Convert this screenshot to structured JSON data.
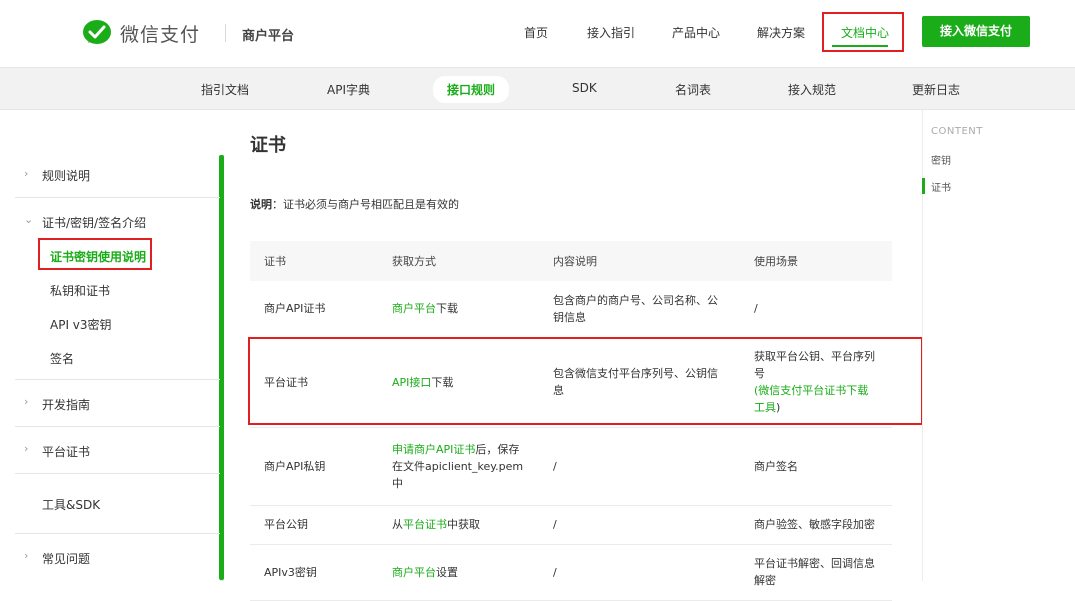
{
  "header": {
    "brand": "微信支付",
    "sub_brand": "商户平台",
    "nav": [
      "首页",
      "接入指引",
      "产品中心",
      "解决方案",
      "文档中心"
    ],
    "nav_active": "文档中心",
    "cta_label": "接入微信支付"
  },
  "subnav": {
    "items": [
      "指引文档",
      "API字典",
      "接口规则",
      "SDK",
      "名词表",
      "接入规范",
      "更新日志"
    ],
    "active": "接口规则"
  },
  "sidebar": {
    "groups": [
      {
        "label": "规则说明"
      },
      {
        "label": "证书/密钥/签名介绍",
        "children": [
          "证书密钥使用说明",
          "私钥和证书",
          "API v3密钥",
          "签名"
        ],
        "active_child": "证书密钥使用说明"
      },
      {
        "label": "开发指南"
      },
      {
        "label": "平台证书"
      },
      {
        "label": "工具&SDK"
      },
      {
        "label": "常见问题"
      }
    ]
  },
  "main": {
    "title": "证书",
    "note_label": "说明",
    "note_text": "：证书必须与商户号相匹配且是有效的",
    "table": {
      "headers": [
        "证书",
        "获取方式",
        "内容说明",
        "使用场景"
      ],
      "rows": [
        {
          "name": "商户API证书",
          "method_link": "商户平台",
          "method_suffix": "下载",
          "content": "包含商户的商户号、公司名称、公钥信息",
          "usage": "/"
        },
        {
          "name": "平台证书",
          "method_link": "API接口",
          "method_suffix": "下载",
          "content": "包含微信支付平台序列号、公钥信息",
          "usage_prefix": "获取平台公钥、平台序列号",
          "usage_link": "(微信支付平台证书下载工具",
          "usage_suffix": ")"
        },
        {
          "name": "商户API私钥",
          "method_link": "申请商户API证书",
          "method_suffix": "后，保存在文件apiclient_key.pem中",
          "content": "/",
          "usage": "商户签名"
        },
        {
          "name": "平台公钥",
          "method_prefix": "从",
          "method_link": "平台证书",
          "method_suffix": "中获取",
          "content": "/",
          "usage": "商户验签、敏感字段加密"
        },
        {
          "name": "APIv3密钥",
          "method_link": "商户平台",
          "method_suffix": "设置",
          "content": "/",
          "usage": "平台证书解密、回调信息解密"
        }
      ]
    }
  },
  "toc": {
    "title": "CONTENT",
    "items": [
      "密钥",
      "证书"
    ],
    "active": "证书"
  },
  "colors": {
    "accent": "#1aad19",
    "highlight_box": "#e02020"
  }
}
